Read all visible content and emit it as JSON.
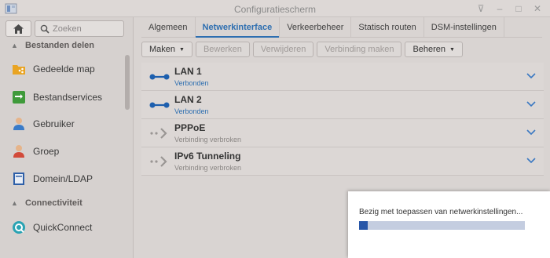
{
  "window": {
    "title": "Configuratiescherm"
  },
  "sidebar": {
    "search_placeholder": "Zoeken",
    "sections": [
      {
        "label": "Bestanden delen"
      },
      {
        "label": "Connectiviteit"
      }
    ],
    "items": [
      {
        "label": "Gedeelde map",
        "icon": "shared-folder-icon"
      },
      {
        "label": "Bestandservices",
        "icon": "file-services-icon"
      },
      {
        "label": "Gebruiker",
        "icon": "user-icon"
      },
      {
        "label": "Groep",
        "icon": "group-icon"
      },
      {
        "label": "Domein/LDAP",
        "icon": "domain-ldap-icon"
      },
      {
        "label": "QuickConnect",
        "icon": "quickconnect-icon"
      }
    ]
  },
  "tabs": [
    {
      "label": "Algemeen"
    },
    {
      "label": "Netwerkinterface",
      "active": true
    },
    {
      "label": "Verkeerbeheer"
    },
    {
      "label": "Statisch routen"
    },
    {
      "label": "DSM-instellingen"
    }
  ],
  "toolbar": {
    "create_label": "Maken",
    "edit_label": "Bewerken",
    "delete_label": "Verwijderen",
    "connect_label": "Verbinding maken",
    "manage_label": "Beheren"
  },
  "interfaces": [
    {
      "name": "LAN 1",
      "status": "Verbonden",
      "connected": true
    },
    {
      "name": "LAN 2",
      "status": "Verbonden",
      "connected": true
    },
    {
      "name": "PPPoE",
      "status": "Verbinding verbroken",
      "connected": false
    },
    {
      "name": "IPv6 Tunneling",
      "status": "Verbinding verbroken",
      "connected": false
    }
  ],
  "dialog": {
    "message": "Bezig met toepassen van netwerkinstellingen...",
    "progress": 0.05
  },
  "colors": {
    "accent": "#2d6eb0",
    "progress_fill": "#2756a8",
    "progress_track": "#c4cde0"
  }
}
